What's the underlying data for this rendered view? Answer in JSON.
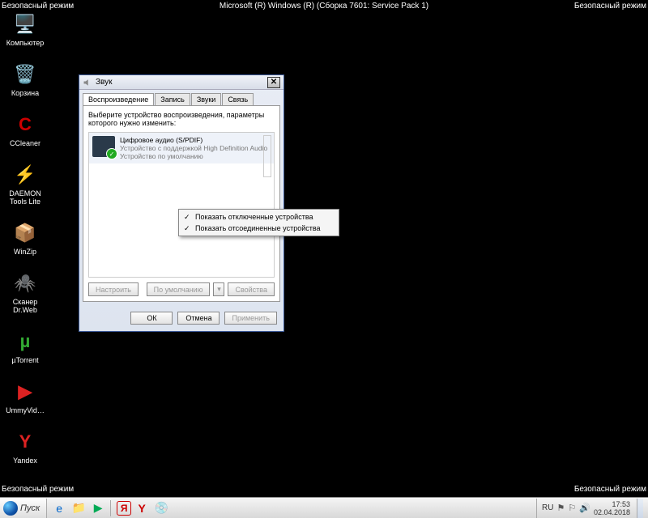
{
  "safemode_corner": "Безопасный режим",
  "watermark": "Microsoft (R) Windows (R) (Сборка 7601: Service Pack 1)",
  "desktop": [
    {
      "label": "Компьютер",
      "name": "computer",
      "glyph": "🖥️"
    },
    {
      "label": "Корзина",
      "name": "recycle-bin",
      "glyph": "🗑️"
    },
    {
      "label": "CCleaner",
      "name": "ccleaner",
      "glyph": "C",
      "col": "#c00"
    },
    {
      "label": "DAEMON Tools Lite",
      "name": "daemon-tools",
      "glyph": "⚡",
      "col": "#38f"
    },
    {
      "label": "WinZip",
      "name": "winzip",
      "glyph": "📦",
      "col": "#fa0"
    },
    {
      "label": "Сканер Dr.Web",
      "name": "drweb",
      "glyph": "🕷️"
    },
    {
      "label": "µTorrent",
      "name": "utorrent",
      "glyph": "µ",
      "col": "#3a3"
    },
    {
      "label": "UmmyVid…",
      "name": "ummy",
      "glyph": "▶",
      "col": "#d22"
    },
    {
      "label": "Yandex",
      "name": "yandex",
      "glyph": "Y",
      "col": "#d22"
    }
  ],
  "window": {
    "title": "Звук",
    "tabs": [
      "Воспроизведение",
      "Запись",
      "Звуки",
      "Связь"
    ],
    "instruction": "Выберите устройство воспроизведения, параметры которого нужно изменить:",
    "device": {
      "name": "Цифровое аудио (S/PDIF)",
      "desc1": "Устройство с поддержкой High Definition Audio",
      "desc2": "Устройство по умолчанию"
    },
    "configure_btn": "Настроить",
    "default_btn": "По умолчанию",
    "properties_btn": "Свойства",
    "ok_btn": "ОК",
    "cancel_btn": "Отмена",
    "apply_btn": "Применить"
  },
  "context_menu": [
    "Показать отключенные устройства",
    "Показать отсоединенные устройства"
  ],
  "taskbar": {
    "start": "Пуск",
    "lang": "RU",
    "time": "17:53",
    "date": "02.04.2018"
  }
}
